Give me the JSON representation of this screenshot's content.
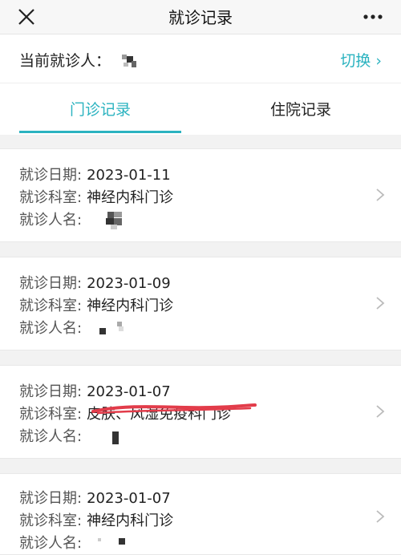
{
  "header": {
    "title": "就诊记录",
    "close_icon": "close-icon",
    "more_icon": "more-icon"
  },
  "patient": {
    "label": "当前就诊人：",
    "switch_label": "切换"
  },
  "tabs": [
    {
      "label": "门诊记录",
      "active": true
    },
    {
      "label": "住院记录",
      "active": false
    }
  ],
  "colors": {
    "accent": "#2bb3c0",
    "annotation": "#e23c4a"
  },
  "labels": {
    "date": "就诊日期:",
    "dept": "就诊科室:",
    "name": "就诊人名:"
  },
  "records": [
    {
      "date": "2023-01-11",
      "dept": "神经内科门诊"
    },
    {
      "date": "2023-01-09",
      "dept": "神经内科门诊"
    },
    {
      "date": "2023-01-07",
      "dept": "皮肤、风湿免疫科门诊"
    },
    {
      "date": "2023-01-07",
      "dept": "神经内科门诊"
    }
  ]
}
